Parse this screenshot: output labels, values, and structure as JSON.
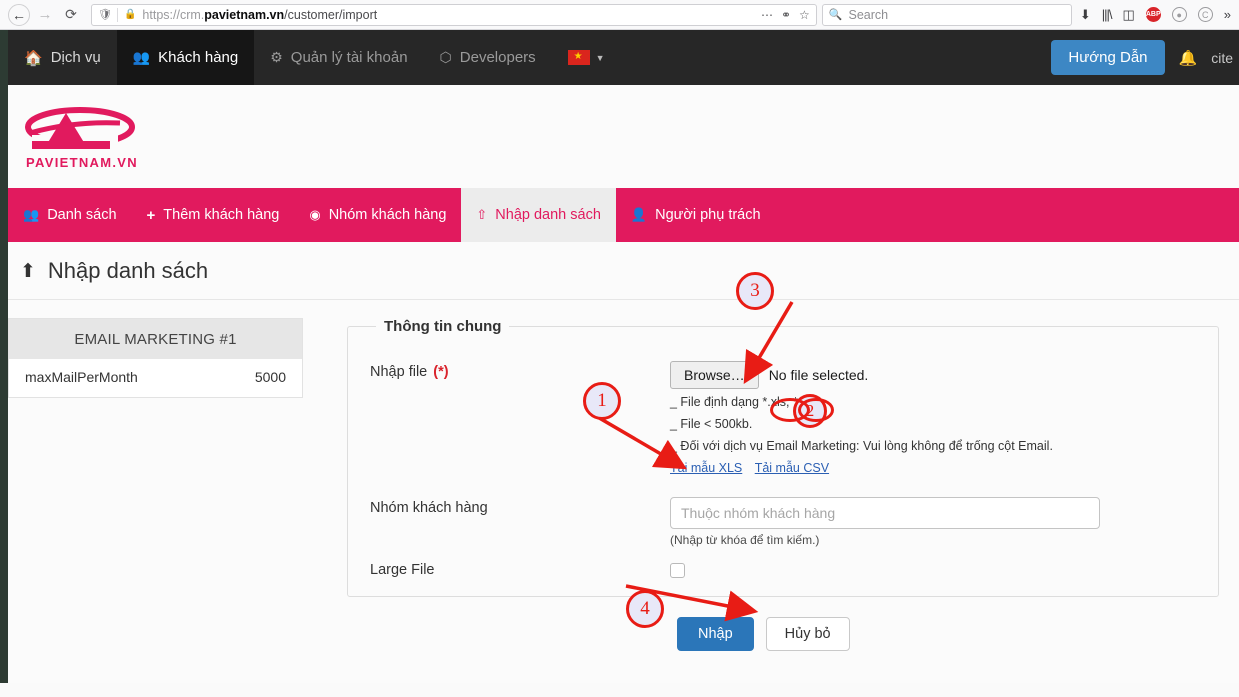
{
  "browser": {
    "url_prefix": "https://crm.",
    "url_domain": "pavietnam.vn",
    "url_path": "/customer/import",
    "search_placeholder": "Search",
    "icons": {
      "back": "back-arrow-icon",
      "forward": "forward-arrow-icon",
      "reload": "reload-icon",
      "shield": "shield-icon",
      "lock": "lock-icon",
      "ellipsis": "ellipsis-icon",
      "pocket": "pocket-icon",
      "star": "star-icon",
      "search": "search-icon",
      "download": "download-icon",
      "library": "library-icon",
      "sidebar": "sidebar-icon",
      "adblock": "ABP",
      "account": "account-icon",
      "container": "C",
      "overflow": "chevron-double-right-icon"
    }
  },
  "topnav": {
    "items": [
      {
        "label": "Dịch vụ",
        "icon": "home-icon",
        "active": false
      },
      {
        "label": "Khách hàng",
        "icon": "users-icon",
        "active": true
      },
      {
        "label": "Quản lý tài khoản",
        "icon": "gears-icon",
        "active": false
      },
      {
        "label": "Developers",
        "icon": "hexagon-icon",
        "active": false
      }
    ],
    "language_flag": "vietnam-flag-icon",
    "help_button": "Hướng Dẫn",
    "bell": "bell-icon",
    "user_truncated": "cite"
  },
  "brand": {
    "logo_text": "PAVIETNAM.VN",
    "logo_mark": "pa-logo-icon",
    "color": "#e11a5e"
  },
  "tabs": [
    {
      "label": "Danh sách",
      "icon": "users-icon",
      "active": false
    },
    {
      "label": "Thêm khách hàng",
      "icon": "plus-icon",
      "active": false
    },
    {
      "label": "Nhóm khách hàng",
      "icon": "circle-user-icon",
      "active": false
    },
    {
      "label": "Nhập danh sách",
      "icon": "upload-icon",
      "active": true
    },
    {
      "label": "Người phụ trách",
      "icon": "person-icon",
      "active": false
    }
  ],
  "page": {
    "title": "Nhập danh sách",
    "title_icon": "upload-icon"
  },
  "sidecard": {
    "header": "EMAIL MARKETING #1",
    "rows": [
      {
        "key": "maxMailPerMonth",
        "value": "5000"
      }
    ]
  },
  "form": {
    "legend": "Thông tin chung",
    "file_field": {
      "label": "Nhập file",
      "required_mark": "(*)",
      "browse_label": "Browse…",
      "no_file_text": "No file selected.",
      "hints": [
        "_ File định dạng *.xls, *.csv.",
        "_ File < 500kb.",
        "_ Đối với dịch vụ Email Marketing: Vui lòng không để trống cột Email."
      ],
      "links": [
        "Tải mẫu XLS",
        "Tải mẫu CSV"
      ]
    },
    "group_field": {
      "label": "Nhóm khách hàng",
      "placeholder": "Thuộc nhóm khách hàng",
      "value": "",
      "hint": "(Nhập từ khóa để tìm kiếm.)"
    },
    "large_file_field": {
      "label": "Large File",
      "checked": false
    },
    "submit_label": "Nhập",
    "cancel_label": "Hủy bỏ"
  },
  "annotations": {
    "markers": [
      {
        "id": "1",
        "label": "1"
      },
      {
        "id": "2",
        "label": "2"
      },
      {
        "id": "3",
        "label": "3"
      },
      {
        "id": "4",
        "label": "4"
      }
    ],
    "color": "#e81c15"
  }
}
